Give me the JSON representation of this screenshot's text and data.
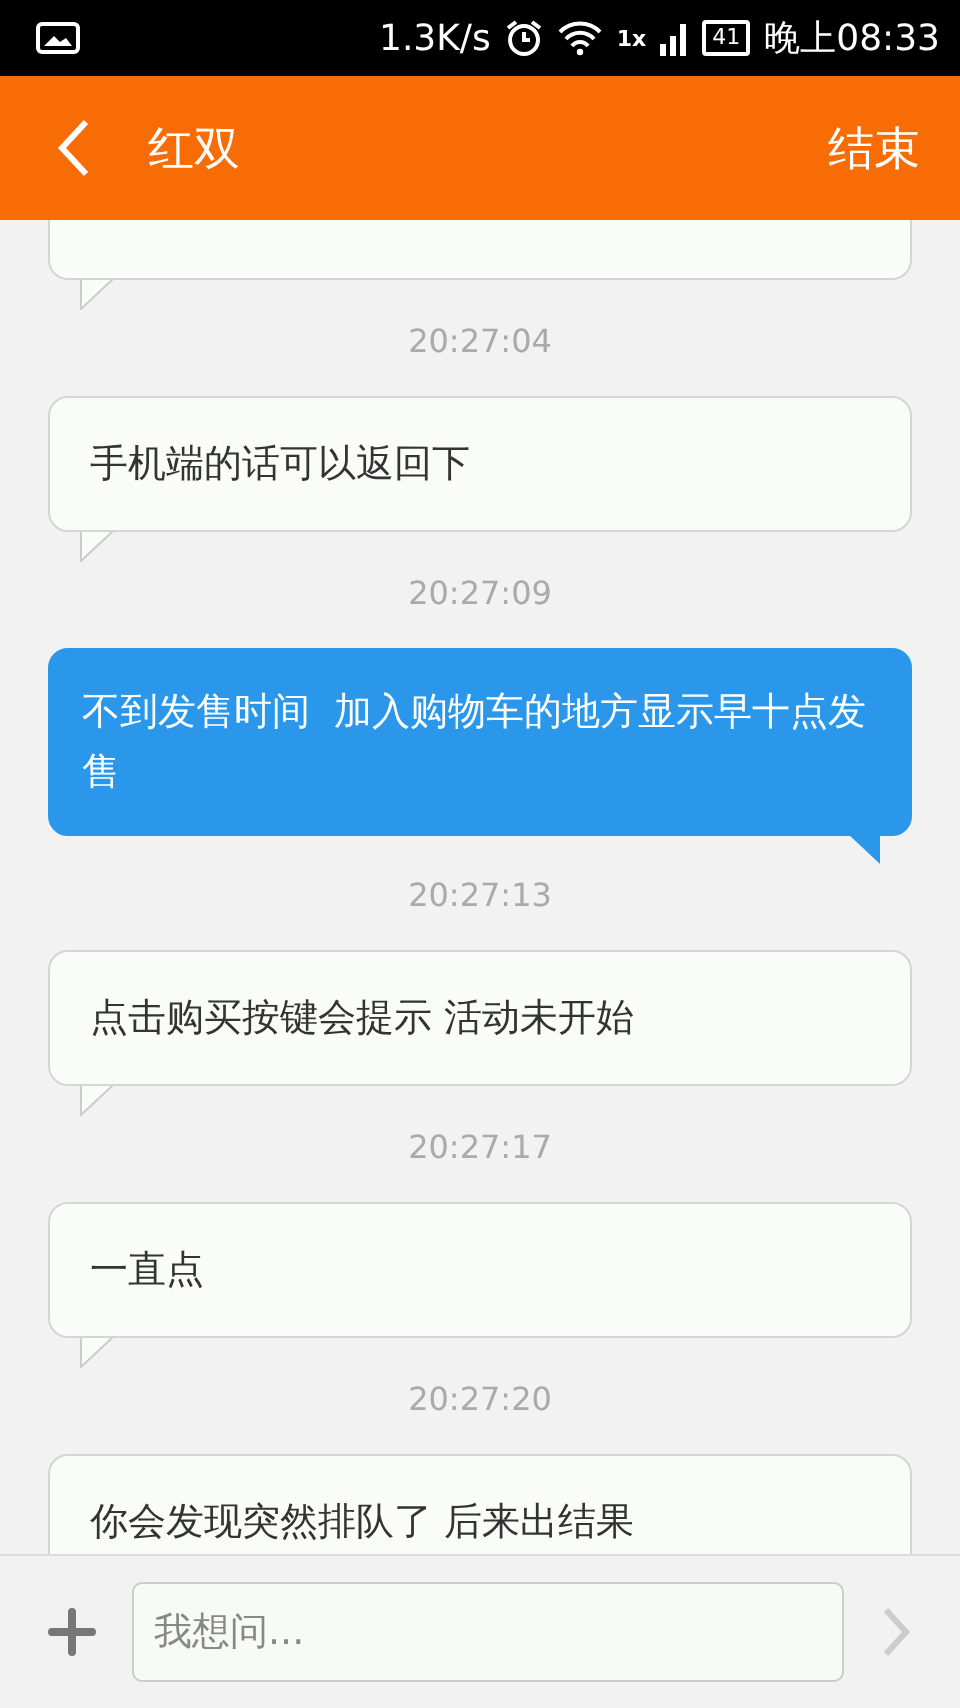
{
  "status_bar": {
    "speed": "1.3K/s",
    "network": "1x",
    "battery": "41",
    "time": "晚上08:33"
  },
  "header": {
    "title": "红双",
    "action": "结束"
  },
  "messages": [
    {
      "kind": "cut_incoming"
    },
    {
      "kind": "time",
      "text": "20:27:04"
    },
    {
      "kind": "incoming",
      "text": "手机端的话可以返回下"
    },
    {
      "kind": "time",
      "text": "20:27:09"
    },
    {
      "kind": "outgoing",
      "text": "不到发售时间  加入购物车的地方显示早十点发售"
    },
    {
      "kind": "time",
      "text": "20:27:13"
    },
    {
      "kind": "incoming",
      "text": "点击购买按键会提示 活动未开始"
    },
    {
      "kind": "time",
      "text": "20:27:17"
    },
    {
      "kind": "incoming",
      "text": "一直点"
    },
    {
      "kind": "time",
      "text": "20:27:20"
    },
    {
      "kind": "incoming",
      "text": "你会发现突然排队了 后来出结果"
    }
  ],
  "input": {
    "placeholder": "我想问..."
  }
}
